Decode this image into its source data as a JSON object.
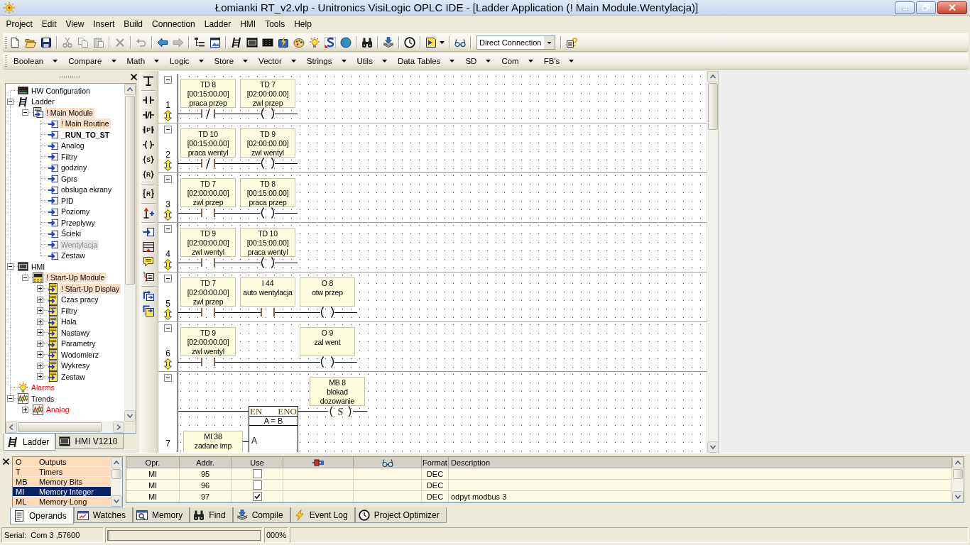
{
  "window": {
    "title": "Łomianki RT_v2.vlp - Unitronics VisiLogic OPLC IDE - [Ladder Application (! Main Module.Wentylacja)]"
  },
  "menu": [
    "Project",
    "Edit",
    "View",
    "Insert",
    "Build",
    "Connection",
    "Ladder",
    "HMI",
    "Tools",
    "Help"
  ],
  "toolbar": {
    "groups": [
      [
        {
          "kind": "new",
          "disabled": false
        },
        {
          "kind": "open",
          "disabled": false
        },
        {
          "kind": "save",
          "disabled": false
        }
      ],
      [
        {
          "kind": "cut",
          "disabled": true
        },
        {
          "kind": "copy",
          "disabled": true
        },
        {
          "kind": "paste",
          "disabled": true
        }
      ],
      [
        {
          "kind": "delete",
          "disabled": true
        }
      ],
      [
        {
          "kind": "undo",
          "disabled": true
        }
      ],
      [
        {
          "kind": "back",
          "disabled": false
        },
        {
          "kind": "forward",
          "disabled": true
        }
      ],
      [
        {
          "kind": "tree",
          "disabled": false
        },
        {
          "kind": "window",
          "disabled": false
        }
      ],
      [
        {
          "kind": "ladder",
          "disabled": false
        },
        {
          "kind": "hmi",
          "disabled": false
        },
        {
          "kind": "lcd",
          "disabled": false
        },
        {
          "kind": "compile",
          "disabled": false
        },
        {
          "kind": "palette",
          "disabled": false
        },
        {
          "kind": "bulb",
          "disabled": false
        },
        {
          "kind": "swirl",
          "disabled": false
        },
        {
          "kind": "globe",
          "disabled": false
        }
      ],
      [
        {
          "kind": "binoculars",
          "disabled": false
        }
      ],
      [
        {
          "kind": "download",
          "disabled": false
        }
      ],
      [
        {
          "kind": "clock",
          "disabled": false
        }
      ],
      [
        {
          "kind": "screen_menu",
          "disabled": false
        }
      ],
      [
        {
          "kind": "glasses",
          "disabled": false
        }
      ]
    ],
    "connection": {
      "value": "Direct Connection"
    },
    "help_button": {
      "kind": "help",
      "disabled": false
    }
  },
  "function_bar": [
    "Boolean",
    "Compare",
    "Math",
    "Logic",
    "Store",
    "Vector",
    "Strings",
    "Utils",
    "Data Tables",
    "SD",
    "Com",
    "FB's"
  ],
  "project_tree": {
    "items": [
      {
        "label": "HW Configuration",
        "kind": "hw",
        "selected": false
      },
      {
        "label": "Ladder",
        "kind": "ladder",
        "expanded": true,
        "selected": false,
        "children": [
          {
            "label": "! Main Module",
            "kind": "module",
            "expanded": true,
            "highlighted": true,
            "selected": false,
            "children": [
              {
                "label": "! Main Routine",
                "kind": "routine",
                "highlighted": true,
                "selected": false
              },
              {
                "label": "_RUN_TO_ST",
                "kind": "routine",
                "bold": true,
                "selected": false
              },
              {
                "label": "Analog",
                "kind": "routine",
                "selected": false
              },
              {
                "label": "Filtry",
                "kind": "routine",
                "selected": false
              },
              {
                "label": "godziny",
                "kind": "routine",
                "selected": false
              },
              {
                "label": "Gprs",
                "kind": "routine",
                "selected": false
              },
              {
                "label": "obsluga ekrany",
                "kind": "routine",
                "selected": false
              },
              {
                "label": "PID",
                "kind": "routine",
                "selected": false
              },
              {
                "label": "Poziomy",
                "kind": "routine",
                "selected": false
              },
              {
                "label": "Przeplywy",
                "kind": "routine",
                "selected": false
              },
              {
                "label": "Ścieki",
                "kind": "routine",
                "selected": false
              },
              {
                "label": "Wentylacja",
                "kind": "routine",
                "selected": true
              },
              {
                "label": "Zestaw",
                "kind": "routine",
                "selected": false
              }
            ]
          }
        ]
      },
      {
        "label": "HMI",
        "kind": "hmi",
        "expanded": true,
        "selected": false,
        "children": [
          {
            "label": "! Start-Up Module",
            "kind": "hmi_module",
            "expanded": true,
            "highlighted": true,
            "selected": false,
            "children": [
              {
                "label": "! Start-Up Display",
                "kind": "display",
                "expanded": false,
                "highlighted": true,
                "selected": false
              },
              {
                "label": "Czas pracy",
                "kind": "display",
                "expanded": false,
                "selected": false
              },
              {
                "label": "Filtry",
                "kind": "display",
                "expanded": false,
                "selected": false
              },
              {
                "label": "Hala",
                "kind": "display",
                "expanded": false,
                "selected": false
              },
              {
                "label": "Nastawy",
                "kind": "display",
                "expanded": false,
                "selected": false
              },
              {
                "label": "Parametry",
                "kind": "display",
                "expanded": false,
                "selected": false
              },
              {
                "label": "Wodomierz",
                "kind": "display",
                "expanded": false,
                "selected": false
              },
              {
                "label": "Wykresy",
                "kind": "display",
                "expanded": false,
                "selected": false
              },
              {
                "label": "Zestaw",
                "kind": "display",
                "expanded": false,
                "selected": false
              }
            ]
          }
        ]
      },
      {
        "label": "Alarms",
        "kind": "alarm",
        "color": "#ff0000",
        "selected": false
      },
      {
        "label": "Trends",
        "kind": "trend",
        "expanded": true,
        "selected": false,
        "children": [
          {
            "label": "Analog",
            "kind": "trend",
            "expanded": false,
            "color": "#ff0000",
            "selected": false
          }
        ]
      }
    ]
  },
  "panel_tabs": [
    {
      "label": "Ladder",
      "kind": "ladder",
      "selected": true
    },
    {
      "label": "HMI V1210",
      "kind": "hmi",
      "selected": false
    }
  ],
  "ladder_toolbar": [
    [
      {
        "kind": "wire"
      }
    ],
    [
      {
        "kind": "no_contact"
      },
      {
        "kind": "nc_contact"
      },
      {
        "kind": "p_contact",
        "glyph": "P"
      },
      {
        "kind": "coil"
      },
      {
        "kind": "set_coil",
        "glyph": "S"
      },
      {
        "kind": "reset_coil",
        "glyph": "R"
      }
    ],
    [
      {
        "kind": "reset_block",
        "glyph": "R"
      }
    ],
    [
      {
        "kind": "add_rung"
      }
    ],
    [
      {
        "kind": "call"
      },
      {
        "kind": "display_strip"
      },
      {
        "kind": "comment"
      },
      {
        "kind": "link"
      }
    ],
    [
      {
        "kind": "copy_rung"
      },
      {
        "kind": "paste_rung"
      }
    ]
  ],
  "rungs": [
    {
      "number": "1",
      "elements": [
        {
          "kind": "nc_contact",
          "lines": [
            "TD 8",
            "[00:15:00.00]",
            "praca przep"
          ]
        },
        {
          "kind": "coil",
          "lines": [
            "TD 7",
            "[02:00:00.00]",
            "zwl przep"
          ]
        }
      ]
    },
    {
      "number": "2",
      "elements": [
        {
          "kind": "nc_contact",
          "lines": [
            "TD 10",
            "[00:15:00.00]",
            "praca wentyl"
          ]
        },
        {
          "kind": "coil",
          "lines": [
            "TD 9",
            "[02:00:00.00]",
            "zwl wentyl"
          ]
        }
      ]
    },
    {
      "number": "3",
      "elements": [
        {
          "kind": "no_contact",
          "lines": [
            "TD 7",
            "[02:00:00.00]",
            "zwl przep"
          ]
        },
        {
          "kind": "coil",
          "lines": [
            "TD 8",
            "[00:15:00.00]",
            "praca przep"
          ]
        }
      ]
    },
    {
      "number": "4",
      "elements": [
        {
          "kind": "no_contact",
          "lines": [
            "TD 9",
            "[02:00:00.00]",
            "zwl wentyl"
          ]
        },
        {
          "kind": "coil",
          "lines": [
            "TD 10",
            "[00:15:00.00]",
            "praca wentyl"
          ]
        }
      ]
    },
    {
      "number": "5",
      "elements": [
        {
          "kind": "no_contact",
          "lines": [
            "TD 7",
            "[02:00:00.00]",
            "zwl przep"
          ]
        },
        {
          "kind": "no_contact",
          "lines": [
            "I 44",
            "auto wentylacja"
          ]
        },
        {
          "kind": "coil",
          "lines": [
            "O 8",
            "otw przep"
          ]
        }
      ]
    },
    {
      "number": "6",
      "elements": [
        {
          "kind": "no_contact",
          "lines": [
            "TD 9",
            "[02:00:00.00]",
            "zwl wentyl"
          ]
        },
        {
          "kind": "wire"
        },
        {
          "kind": "coil",
          "lines": [
            "O 9",
            "zal went"
          ]
        }
      ]
    },
    {
      "number": "7",
      "elements": [
        {
          "kind": "compare_block",
          "en": "EN",
          "eno": "ENO",
          "title": "A = B",
          "inputs": [
            {
              "pin": "A",
              "lines": [
                "MI 38",
                "zadane imp"
              ]
            }
          ]
        },
        {
          "kind": "set_coil",
          "glyph": "S",
          "lines": [
            "MB 8",
            "blokad",
            "dozowanie"
          ]
        }
      ]
    }
  ],
  "operand_types": [
    {
      "code": "O",
      "name": "Outputs",
      "selected": false
    },
    {
      "code": "T",
      "name": "Timers",
      "selected": false
    },
    {
      "code": "MB",
      "name": "Memory Bits",
      "selected": false
    },
    {
      "code": "MI",
      "name": "Memory Integer",
      "selected": true
    },
    {
      "code": "ML",
      "name": "Memory Long",
      "selected": false
    }
  ],
  "operand_table": {
    "columns": [
      {
        "kind": "text",
        "label": "Opr."
      },
      {
        "kind": "text",
        "label": "Addr."
      },
      {
        "kind": "text",
        "label": "Use"
      },
      {
        "kind": "plug"
      },
      {
        "kind": "glasses"
      },
      {
        "kind": "text",
        "label": "Format"
      },
      {
        "kind": "text",
        "label": "Description"
      }
    ],
    "rows": [
      {
        "opr": "MI",
        "addr": "95",
        "used": false,
        "format": "DEC"
      },
      {
        "opr": "MI",
        "addr": "96",
        "used": false,
        "format": "DEC"
      },
      {
        "opr": "MI",
        "addr": "97",
        "used": true,
        "format": "DEC",
        "description": "odpyt modbus 3"
      }
    ]
  },
  "bottom_tabs": [
    {
      "label": "Operands",
      "kind": "operands",
      "selected": true
    },
    {
      "label": "Watches",
      "kind": "watches",
      "selected": false
    },
    {
      "label": "Memory",
      "kind": "memory",
      "selected": false
    },
    {
      "label": "Find",
      "kind": "binoculars",
      "selected": false
    },
    {
      "label": "Compile",
      "kind": "download",
      "selected": false
    },
    {
      "label": "Event Log",
      "kind": "lightning",
      "selected": false
    },
    {
      "label": "Project Optimizer",
      "kind": "clock",
      "selected": false
    }
  ],
  "status_bar": {
    "port_label": "Serial:",
    "port": "Com 3 ,57600",
    "progress": {
      "level": 0
    },
    "percent": "000%"
  }
}
